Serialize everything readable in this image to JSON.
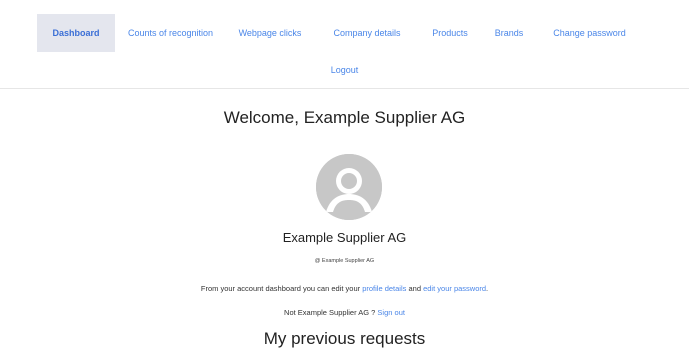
{
  "nav": {
    "items": [
      {
        "label": "Dashboard",
        "active": true
      },
      {
        "label": "Counts of recognition"
      },
      {
        "label": "Webpage clicks"
      },
      {
        "label": "Company details"
      },
      {
        "label": "Products"
      },
      {
        "label": "Brands"
      },
      {
        "label": "Change password"
      }
    ],
    "logout_label": "Logout"
  },
  "welcome": {
    "text": "Welcome,  Example Supplier AG"
  },
  "profile": {
    "name": "Example Supplier AG",
    "handle": "@ Example Supplier AG"
  },
  "dashboard_text": {
    "prefix": "From your account dashboard you can edit your ",
    "profile_link": "profile details",
    "middle": " and ",
    "password_link": "edit your password",
    "suffix": "."
  },
  "signout": {
    "prefix": "Not Example Supplier AG ? ",
    "link": "Sign out"
  },
  "requests": {
    "heading": "My previous requests"
  },
  "colors": {
    "link": "#4a86e8",
    "active_tab_bg": "#e4e6ee",
    "avatar_bg": "#c7c7c7"
  },
  "icons": {
    "avatar": "user-avatar-icon"
  }
}
